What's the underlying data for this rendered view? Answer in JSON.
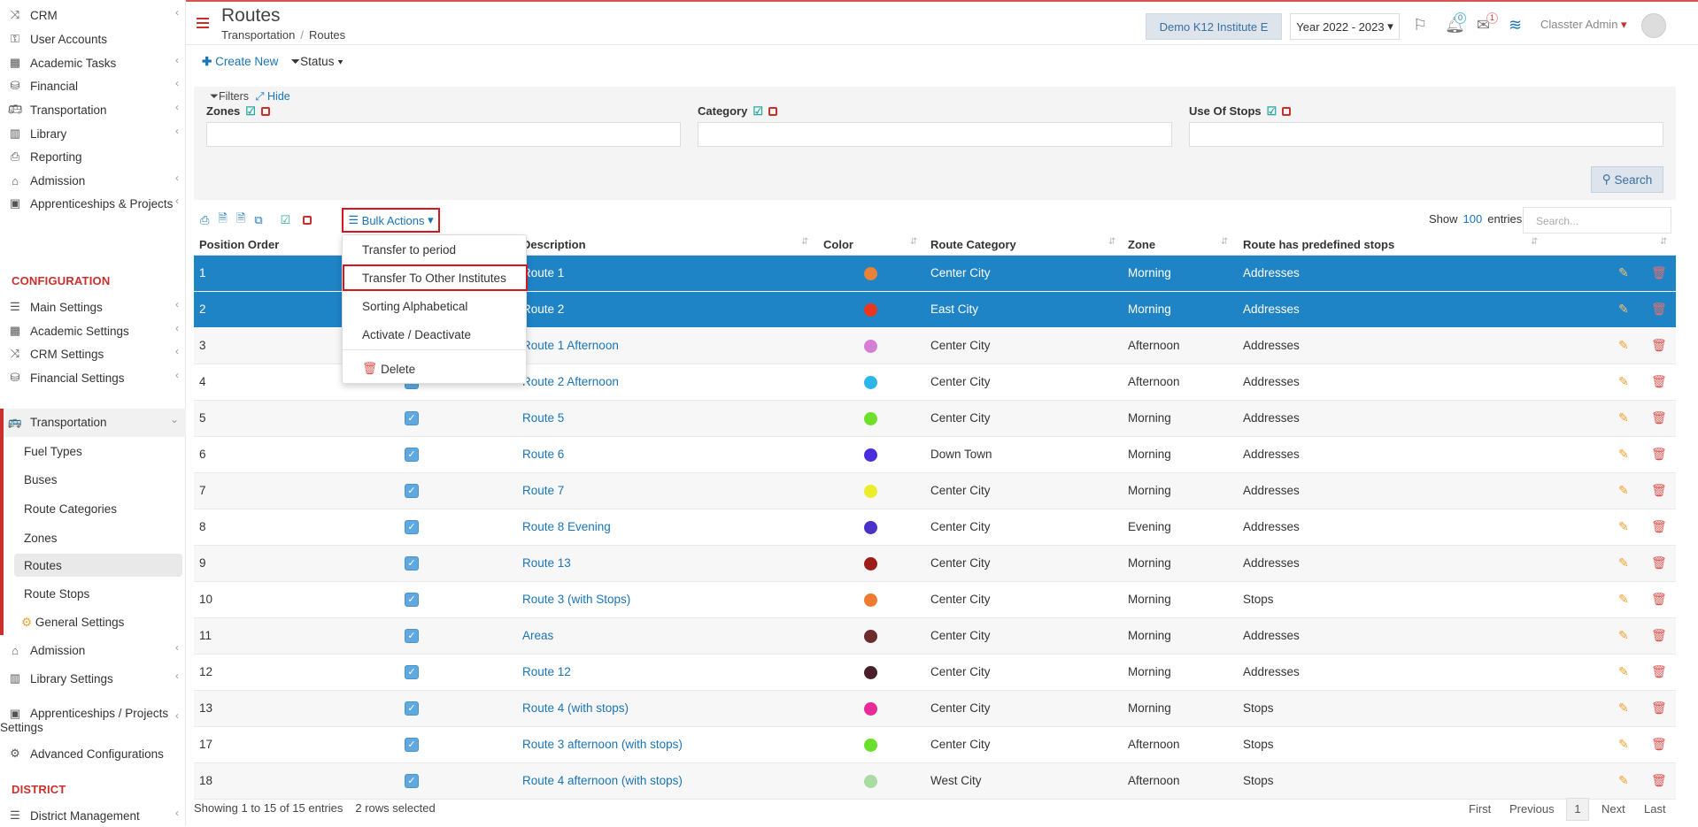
{
  "sidebar": {
    "items_top": [
      {
        "icon": "shuffle-icon",
        "label": "CRM",
        "chev": true
      },
      {
        "icon": "key-icon",
        "label": "User Accounts",
        "chev": false
      },
      {
        "icon": "grid-icon",
        "label": "Academic Tasks",
        "chev": true
      },
      {
        "icon": "coins-icon",
        "label": "Financial",
        "chev": true
      },
      {
        "icon": "bus-icon",
        "label": "Transportation",
        "chev": true
      },
      {
        "icon": "books-icon",
        "label": "Library",
        "chev": true
      },
      {
        "icon": "printer-icon",
        "label": "Reporting",
        "chev": false
      },
      {
        "icon": "bank-icon",
        "label": "Admission",
        "chev": true
      },
      {
        "icon": "box-icon",
        "label": "Apprenticeships & Projects",
        "chev": true
      }
    ],
    "configuration_heading": "CONFIGURATION",
    "config_items": [
      {
        "icon": "sliders-icon",
        "label": "Main Settings",
        "chev": true
      },
      {
        "icon": "grid-icon",
        "label": "Academic Settings",
        "chev": true
      },
      {
        "icon": "shuffle-icon",
        "label": "CRM Settings",
        "chev": true
      },
      {
        "icon": "coins-icon",
        "label": "Financial Settings",
        "chev": true
      }
    ],
    "transportation": {
      "label": "Transportation",
      "icon": "bus-icon"
    },
    "transport_sub": [
      "Fuel Types",
      "Buses",
      "Route Categories",
      "Zones",
      "Routes",
      "Route Stops",
      "General Settings"
    ],
    "config_items_after": [
      {
        "icon": "bank-icon",
        "label": "Admission",
        "chev": true
      },
      {
        "icon": "books-icon",
        "label": "Library Settings",
        "chev": true
      }
    ],
    "apprenticeships_settings_line1": "Apprenticeships / Projects",
    "apprenticeships_settings_line2": "Settings",
    "advanced": "Advanced Configurations",
    "district_heading": "DISTRICT",
    "district_mgmt": "District Management"
  },
  "header": {
    "title": "Routes",
    "breadcrumb": [
      "Transportation",
      "Routes"
    ],
    "institute": "Demo K12 Institute E",
    "year": "Year 2022 - 2023",
    "notif_badge": "0",
    "mail_badge": "1",
    "user": "Classter Admin"
  },
  "toolbar": {
    "create": "Create New",
    "status": "Status"
  },
  "filters": {
    "title": "Filters",
    "hide": "Hide",
    "fields": [
      "Zones",
      "Category",
      "Use Of Stops"
    ],
    "search_btn": "Search"
  },
  "table_tools": {
    "bulk": "Bulk Actions",
    "show_label": "Show",
    "show_count": "100",
    "show_entries": "entries",
    "search_placeholder": "Search..."
  },
  "bulk_menu": {
    "items": [
      "Transfer to period",
      "Transfer To Other Institutes",
      "Sorting Alphabetical",
      "Activate / Deactivate"
    ],
    "delete": "Delete"
  },
  "columns": [
    "Position Order",
    "Description",
    "Color",
    "Route Category",
    "Zone",
    "Route has predefined stops"
  ],
  "rows": [
    {
      "pos": "1",
      "desc": "Route 1",
      "color": "#e8813a",
      "category": "Center City",
      "zone": "Morning",
      "stops": "Addresses",
      "selected": true
    },
    {
      "pos": "2",
      "desc": "Route 2",
      "color": "#e8361f",
      "category": "East City",
      "zone": "Morning",
      "stops": "Addresses",
      "selected": true
    },
    {
      "pos": "3",
      "desc": "Route 1 Afternoon",
      "color": "#d67ed6",
      "category": "Center City",
      "zone": "Afternoon",
      "stops": "Addresses",
      "selected": false
    },
    {
      "pos": "4",
      "desc": "Route 2 Afternoon",
      "color": "#2bb5e8",
      "category": "Center City",
      "zone": "Afternoon",
      "stops": "Addresses",
      "selected": false
    },
    {
      "pos": "5",
      "desc": "Route 5",
      "color": "#6fe02a",
      "category": "Center City",
      "zone": "Morning",
      "stops": "Addresses",
      "selected": false
    },
    {
      "pos": "6",
      "desc": "Route 6",
      "color": "#4b2de0",
      "category": "Down Town",
      "zone": "Morning",
      "stops": "Addresses",
      "selected": false
    },
    {
      "pos": "7",
      "desc": "Route 7",
      "color": "#ecec2a",
      "category": "Center City",
      "zone": "Morning",
      "stops": "Addresses",
      "selected": false
    },
    {
      "pos": "8",
      "desc": "Route 8 Evening",
      "color": "#4a32c8",
      "category": "Center City",
      "zone": "Evening",
      "stops": "Addresses",
      "selected": false
    },
    {
      "pos": "9",
      "desc": "Route 13",
      "color": "#9e1b1b",
      "category": "Center City",
      "zone": "Morning",
      "stops": "Addresses",
      "selected": false
    },
    {
      "pos": "10",
      "desc": "Route 3 (with Stops)",
      "color": "#f07a30",
      "category": "Center City",
      "zone": "Morning",
      "stops": "Stops",
      "selected": false
    },
    {
      "pos": "11",
      "desc": "Areas",
      "color": "#6e2b2b",
      "category": "Center City",
      "zone": "Morning",
      "stops": "Addresses",
      "selected": false
    },
    {
      "pos": "12",
      "desc": "Route 12",
      "color": "#4a1f2a",
      "category": "Center City",
      "zone": "Morning",
      "stops": "Addresses",
      "selected": false
    },
    {
      "pos": "13",
      "desc": "Route 4 (with stops)",
      "color": "#e82a9a",
      "category": "Center City",
      "zone": "Morning",
      "stops": "Stops",
      "selected": false
    },
    {
      "pos": "17",
      "desc": "Route 3 afternoon (with stops)",
      "color": "#6ae02a",
      "category": "Center City",
      "zone": "Afternoon",
      "stops": "Stops",
      "selected": false
    },
    {
      "pos": "18",
      "desc": "Route 4 afternoon (with stops)",
      "color": "#a8dca0",
      "category": "West City",
      "zone": "Afternoon",
      "stops": "Stops",
      "selected": false
    }
  ],
  "footer": {
    "showing": "Showing 1 to 15 of 15 entries",
    "selected": "2 rows selected",
    "first": "First",
    "previous": "Previous",
    "page": "1",
    "next": "Next",
    "last": "Last"
  }
}
